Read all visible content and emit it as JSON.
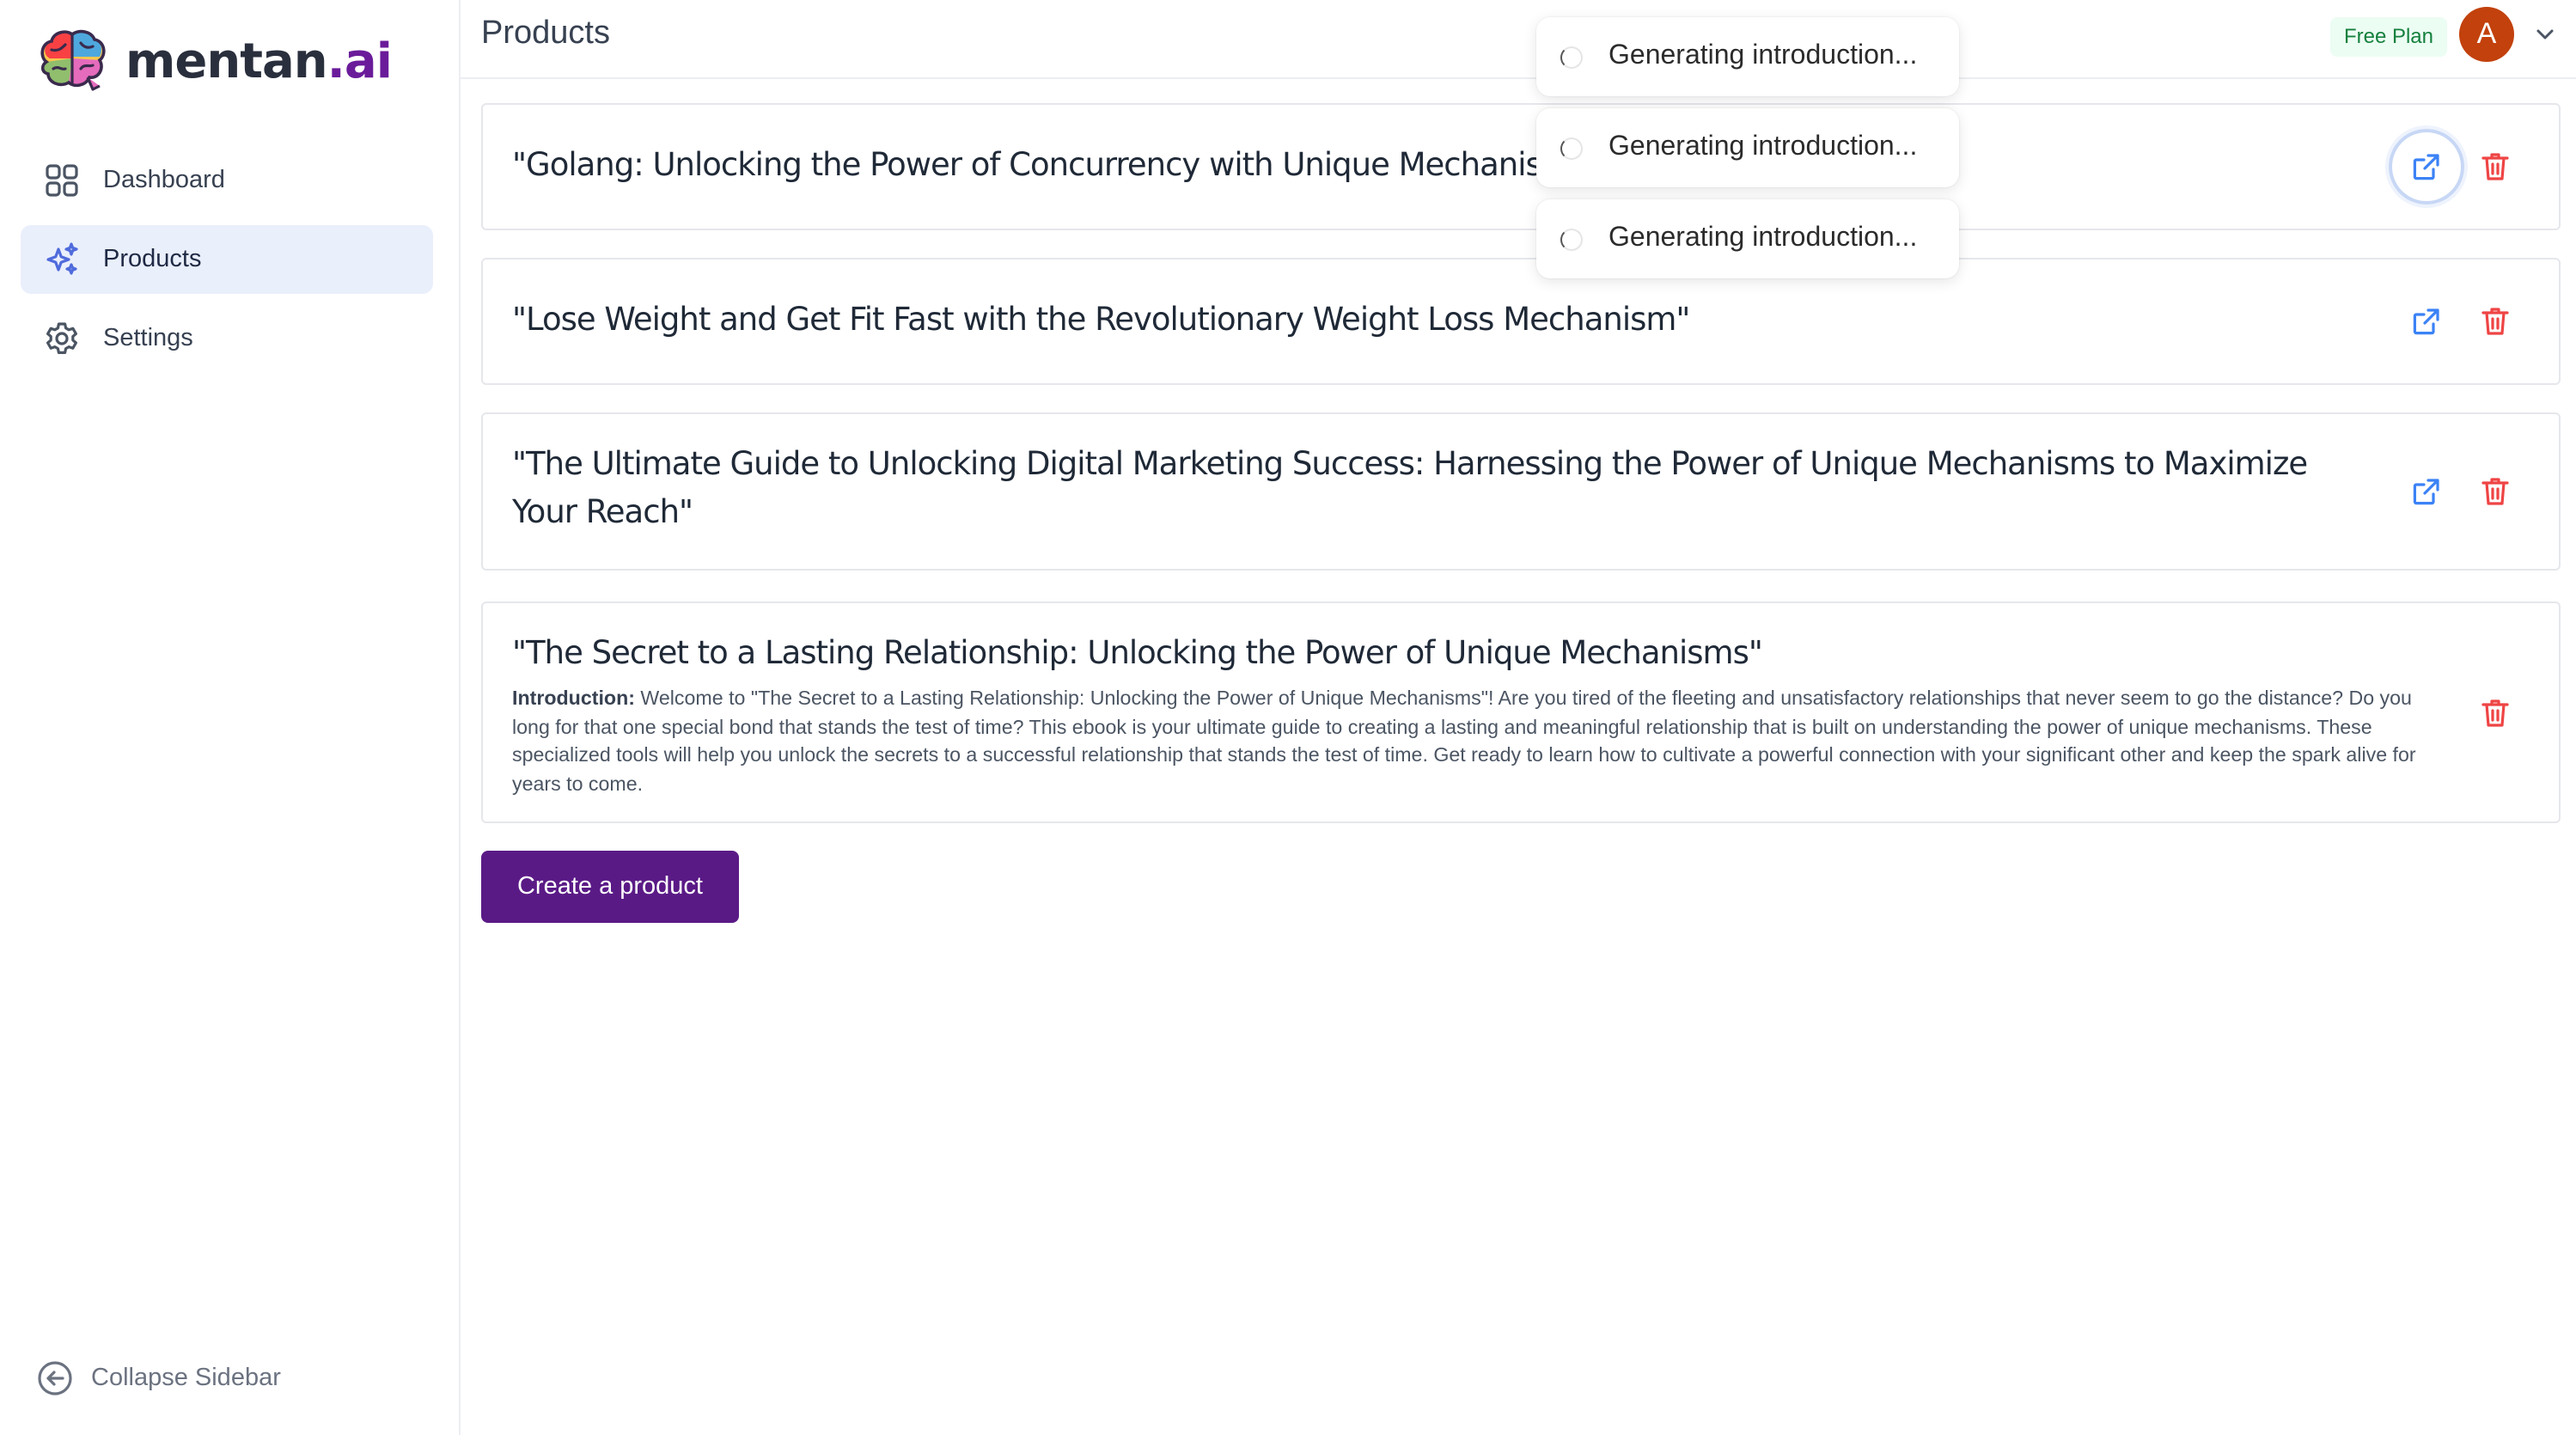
{
  "brand": {
    "name_main": "mentan",
    "name_accent": ".ai"
  },
  "sidebar": {
    "items": [
      {
        "label": "Dashboard",
        "icon": "grid-icon"
      },
      {
        "label": "Products",
        "icon": "sparkles-icon"
      },
      {
        "label": "Settings",
        "icon": "gear-icon"
      }
    ],
    "collapse_label": "Collapse Sidebar"
  },
  "header": {
    "title": "Products",
    "plan": "Free Plan",
    "avatar_initial": "A"
  },
  "products": [
    {
      "title": "\"Golang: Unlocking the Power of Concurrency with Unique Mechanisms\""
    },
    {
      "title": "\"Lose Weight and Get Fit Fast with the Revolutionary Weight Loss Mechanism\""
    },
    {
      "title": "\"The Ultimate Guide to Unlocking Digital Marketing Success: Harnessing the Power of Unique Mechanisms to Maximize Your Reach\""
    },
    {
      "title": "\"The Secret to a Lasting Relationship: Unlocking the Power of Unique Mechanisms\"",
      "intro_label": "Introduction:",
      "intro_text": " Welcome to \"The Secret to a Lasting Relationship: Unlocking the Power of Unique Mechanisms\"! Are you tired of the fleeting and unsatisfactory relationships that never seem to go the distance? Do you long for that one special bond that stands the test of time? This ebook is your ultimate guide to creating a lasting and meaningful relationship that is built on understanding the power of unique mechanisms. These specialized tools will help you unlock the secrets to a successful relationship that stands the test of time. Get ready to learn how to cultivate a powerful connection with your significant other and keep the spark alive for years to come."
    }
  ],
  "create_button": "Create a product",
  "toasts": [
    {
      "text": "Generating introduction..."
    },
    {
      "text": "Generating introduction..."
    },
    {
      "text": "Generating introduction..."
    }
  ],
  "colors": {
    "brand_accent": "#6a1b9a",
    "primary_button": "#5a1a86",
    "edit_icon": "#3b82f6",
    "delete_icon": "#ef4444",
    "active_nav_bg": "#eaeffc",
    "avatar_bg": "#c2410c",
    "plan_badge_text": "#15803d"
  }
}
